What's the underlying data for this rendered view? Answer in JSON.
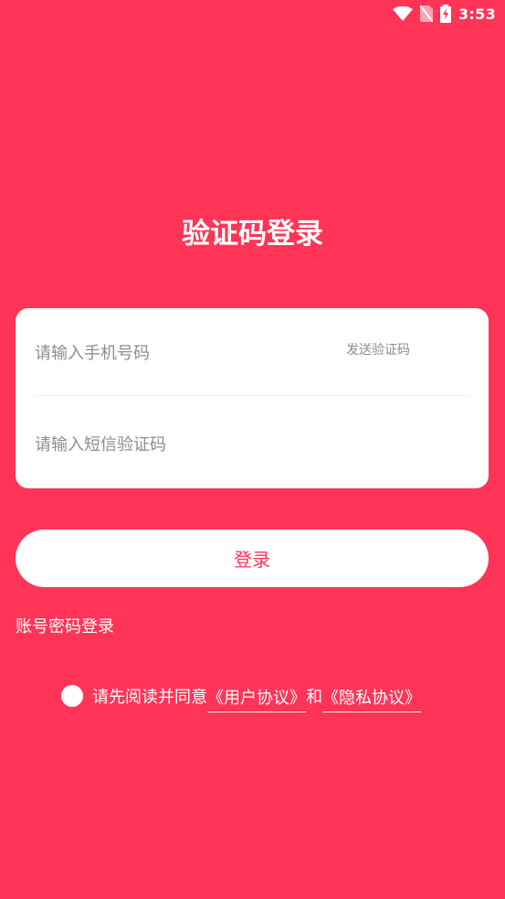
{
  "status_bar": {
    "time": "3:53",
    "icons": [
      "wifi-icon",
      "no-sim-icon",
      "battery-charging-icon"
    ]
  },
  "title": "验证码登录",
  "form": {
    "phone_placeholder": "请输入手机号码",
    "send_code_label": "发送验证码",
    "code_placeholder": "请输入短信验证码"
  },
  "login_button": "登录",
  "password_login_link": "账号密码登录",
  "agreement": {
    "prefix": "请先阅读并同意",
    "user_agreement": "《用户协议》",
    "and": "和",
    "privacy_policy": "《隐私协议》"
  },
  "colors": {
    "background": "#ff3456",
    "accent": "#ff3456",
    "card": "#ffffff",
    "placeholder": "#8c8c8c"
  }
}
